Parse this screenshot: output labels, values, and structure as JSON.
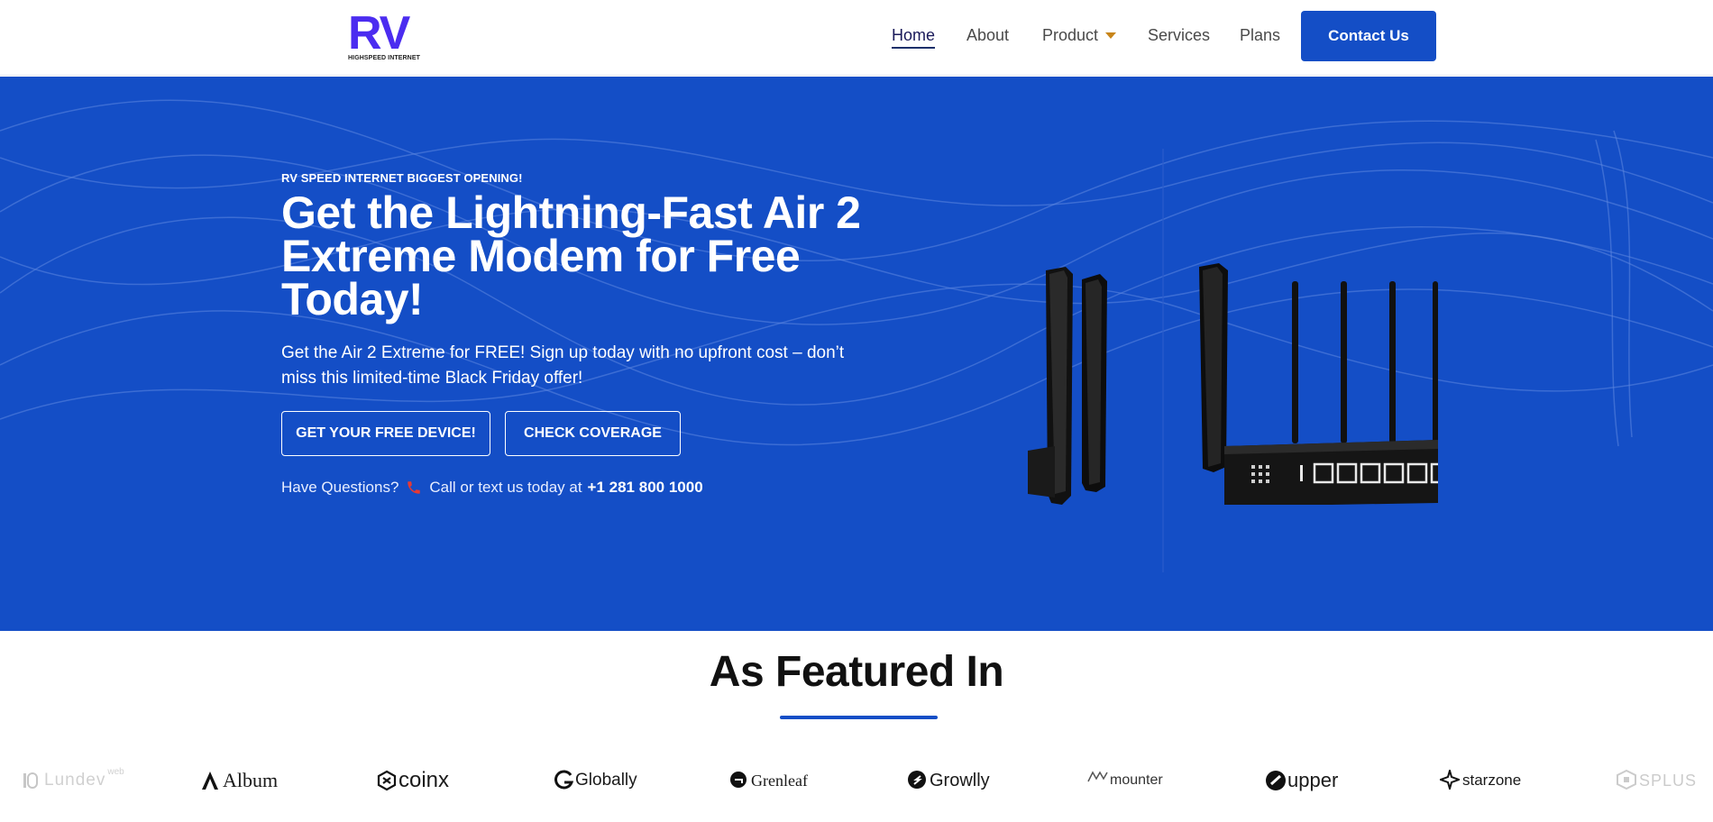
{
  "header": {
    "logo_mark": "RV",
    "logo_sub": "HIGHSPEED INTERNET",
    "nav": [
      {
        "label": "Home",
        "active": true
      },
      {
        "label": "About",
        "active": false
      },
      {
        "label": "Product",
        "active": false,
        "has_dropdown": true
      },
      {
        "label": "Services",
        "active": false
      },
      {
        "label": "Plans",
        "active": false
      }
    ],
    "contact_label": "Contact Us"
  },
  "hero": {
    "eyebrow": "RV SPEED INTERNET BIGGEST OPENING!",
    "headline": "Get the Lightning-Fast Air 2 Extreme Modem for Free Today!",
    "subtext": "Get the Air 2 Extreme for FREE! Sign up today with no upfront cost – don’t miss this limited-time Black Friday offer!",
    "cta_primary": "GET YOUR FREE DEVICE!",
    "cta_secondary": "CHECK COVERAGE",
    "questions_prefix": "Have Questions?",
    "questions_text": "Call or text us today at",
    "phone": "+1 281 800 1000"
  },
  "featured": {
    "title": "As Featured In",
    "brands": [
      {
        "name": "Lundev",
        "sup": "web",
        "icon": "lundev-icon"
      },
      {
        "name": "Album",
        "icon": "album-icon"
      },
      {
        "name": "coinx",
        "icon": "coinx-icon"
      },
      {
        "name": "Globally",
        "icon": "globally-icon"
      },
      {
        "name": "Grenleaf",
        "icon": "grenleaf-icon"
      },
      {
        "name": "Growlly",
        "icon": "growlly-icon"
      },
      {
        "name": "mounter",
        "icon": "mounter-icon"
      },
      {
        "name": "upper",
        "icon": "upper-icon"
      },
      {
        "name": "starzone",
        "icon": "starzone-icon"
      },
      {
        "name": "SPLUS",
        "icon": "splus-icon"
      }
    ]
  },
  "colors": {
    "primary_blue": "#144ec6",
    "logo_purple": "#4b2cf0",
    "caret_orange": "#c8851a",
    "phone_red": "#e53935"
  }
}
